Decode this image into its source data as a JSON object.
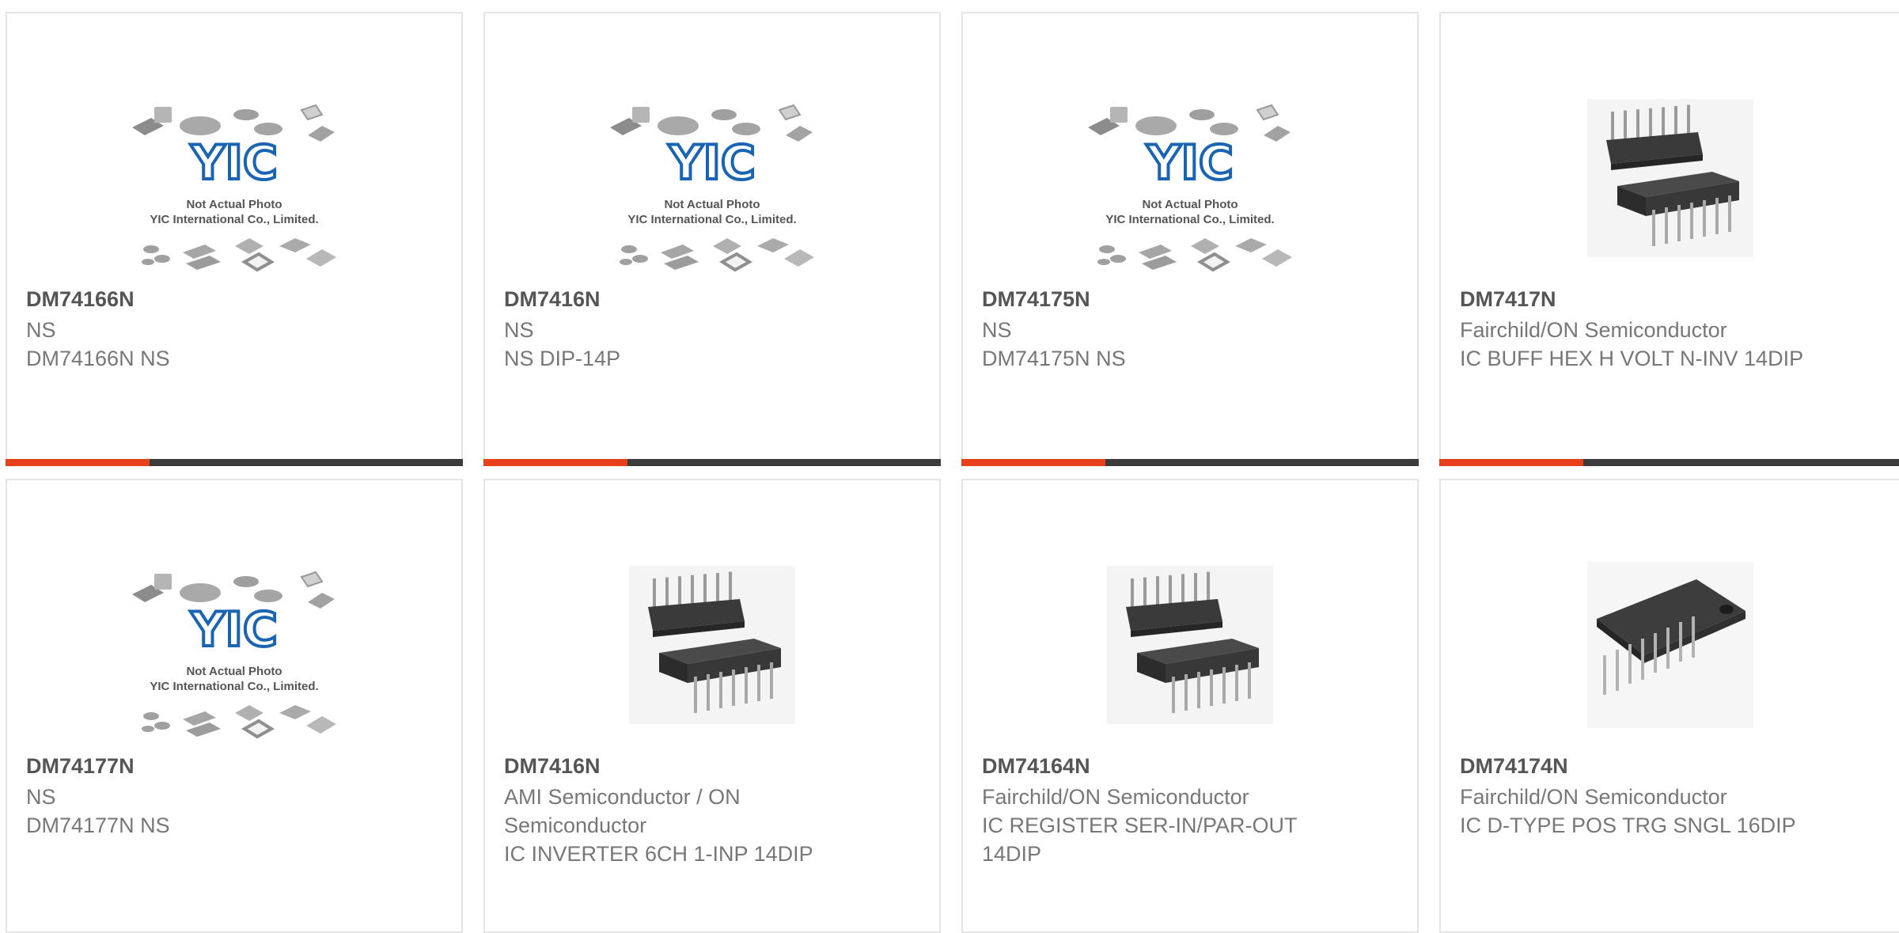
{
  "colors": {
    "accent": "#e8401a",
    "bar": "#3b3b3b",
    "logo_blue": "#1a64b4"
  },
  "placeholder": {
    "logo_text": "YIC",
    "line1": "Not Actual Photo",
    "line2": "YIC International Co., Limited."
  },
  "products": [
    {
      "part_number": "DM74166N",
      "manufacturer": "NS",
      "description": "DM74166N NS",
      "image": "placeholder"
    },
    {
      "part_number": "DM7416N",
      "manufacturer": "NS",
      "description": "NS DIP-14P",
      "image": "placeholder"
    },
    {
      "part_number": "DM74175N",
      "manufacturer": "NS",
      "description": "DM74175N NS",
      "image": "placeholder"
    },
    {
      "part_number": "DM7417N",
      "manufacturer": "Fairchild/ON Semiconductor",
      "description": "IC BUFF HEX H VOLT N-INV 14DIP",
      "image": "dip14"
    },
    {
      "part_number": "DM74177N",
      "manufacturer": "NS",
      "description": "DM74177N NS",
      "image": "placeholder"
    },
    {
      "part_number": "DM7416N",
      "manufacturer": "AMI Semiconductor / ON Semiconductor",
      "description": "IC INVERTER 6CH 1-INP 14DIP",
      "image": "dip14"
    },
    {
      "part_number": "DM74164N",
      "manufacturer": "Fairchild/ON Semiconductor",
      "description": "IC REGISTER SER-IN/PAR-OUT 14DIP",
      "image": "dip14"
    },
    {
      "part_number": "DM74174N",
      "manufacturer": "Fairchild/ON Semiconductor",
      "description": "IC D-TYPE POS TRG SNGL 16DIP",
      "image": "dip16"
    }
  ]
}
